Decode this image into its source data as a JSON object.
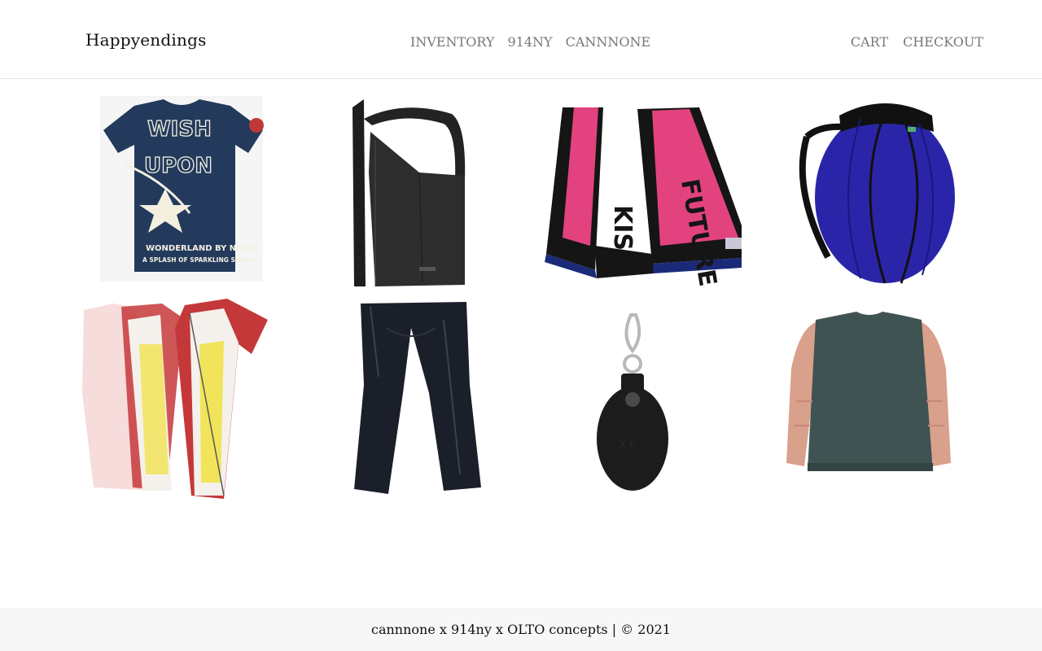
{
  "header": {
    "brand": "Happyendings",
    "nav_center": [
      "INVENTORY",
      "914NY",
      "CANNNONE"
    ],
    "nav_right": [
      "CART",
      "CHECKOUT"
    ]
  },
  "products": [
    {
      "name": "wish-upon-a-star-tee",
      "shirt_text_1": "WONDERLAND BY NIGHT",
      "shirt_text_2": "A SPLASH OF SPARKLING STARS!",
      "colors": {
        "body": "#233a5c",
        "print": "#f3f0e0"
      }
    },
    {
      "name": "black-leather-sling-bag",
      "colors": {
        "body": "#2a2a2a"
      }
    },
    {
      "name": "kiss-the-future-scarf",
      "colors": {
        "pink": "#e2437f",
        "black": "#151515",
        "navy": "#1b2a78"
      }
    },
    {
      "name": "blue-round-backpack",
      "colors": {
        "body": "#2a25a8",
        "trim": "#111111"
      }
    },
    {
      "name": "red-white-yellow-tee",
      "colors": {
        "red": "#c5383a",
        "white": "#f4f1ec",
        "yellow": "#f2e45a"
      }
    },
    {
      "name": "black-nylon-trousers",
      "colors": {
        "body": "#1b1f2a"
      }
    },
    {
      "name": "grenade-keychain",
      "colors": {
        "body": "#1c1c1c",
        "metal": "#b8b8b8"
      }
    },
    {
      "name": "green-knit-salmon-sleeve-top",
      "colors": {
        "body": "#3f5352",
        "sleeve": "#d9a08c"
      }
    }
  ],
  "footer": {
    "text": "cannnone x 914ny x OLTO concepts | © 2021"
  }
}
